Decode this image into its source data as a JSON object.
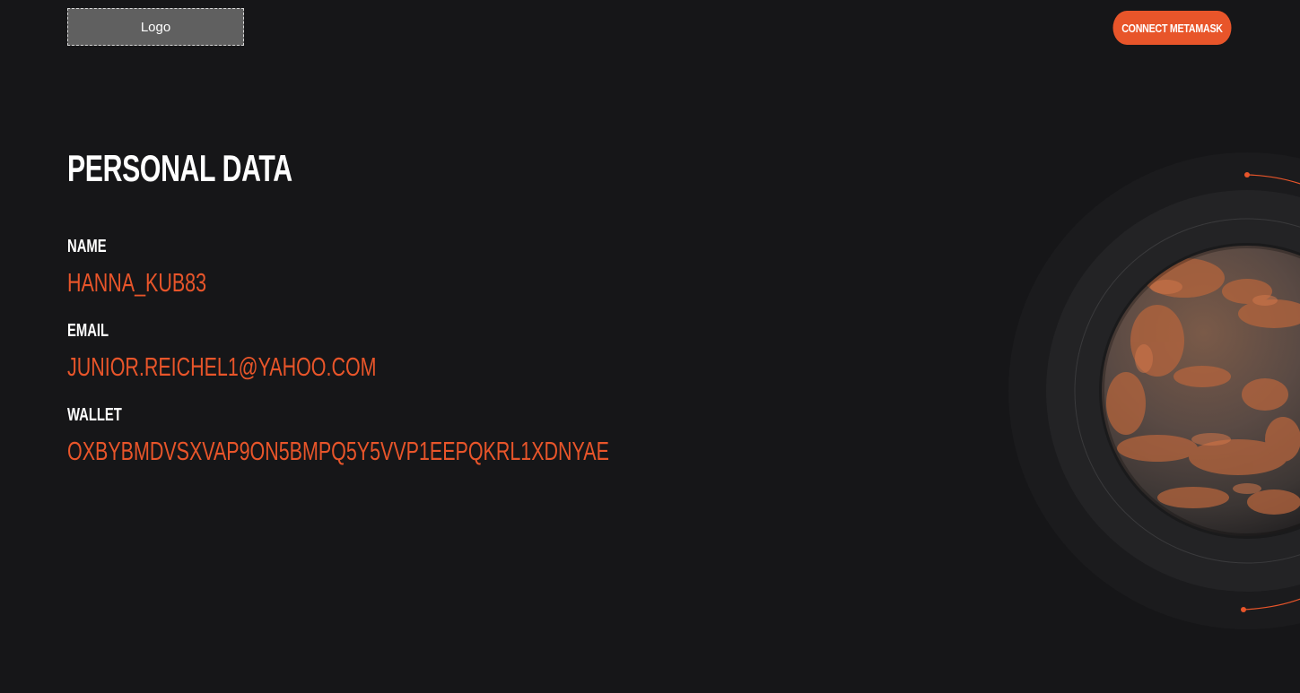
{
  "header": {
    "logo_text": "Logo",
    "connect_label": "CONNECT METAMASK"
  },
  "page": {
    "title": "PERSONAL DATA"
  },
  "fields": {
    "name_label": "NAME",
    "name_value": "HANNA_KUB83",
    "email_label": "EMAIL",
    "email_value": "JUNIOR.REICHEL1@YAHOO.COM",
    "wallet_label": "WALLET",
    "wallet_value": "OXBYBMDVSXVAP9ON5BMPQ5Y5VVP1EEPQKRL1XDNYAE"
  },
  "colors": {
    "background": "#161618",
    "accent": "#e8552a",
    "text": "#ffffff",
    "logo_bg": "#606060"
  },
  "icons": {
    "planet": "planet-illustration"
  }
}
